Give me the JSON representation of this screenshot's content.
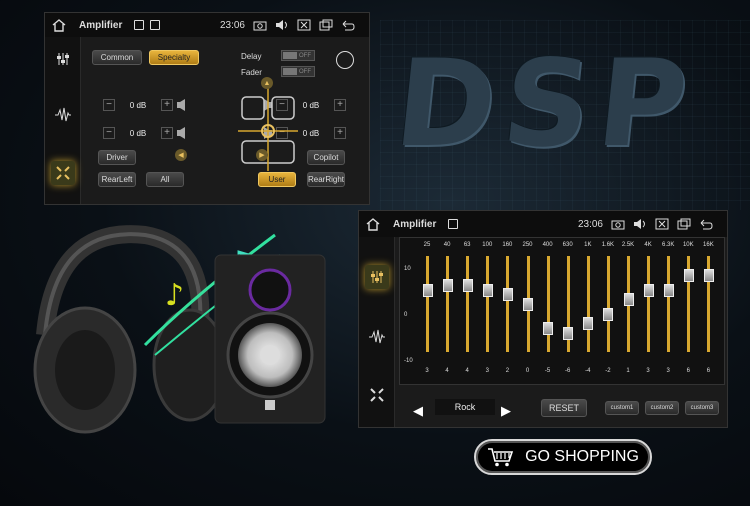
{
  "hero_text": "DSP",
  "amp_panel": {
    "title": "Amplifier",
    "time": "23:06",
    "tabs": [
      "Common",
      "Specialty"
    ],
    "delay_label": "Delay",
    "fader_label": "Fader",
    "toggle_off": "OFF",
    "db_values": [
      "0 dB",
      "0 dB",
      "0 dB",
      "0 dB"
    ],
    "buttons": {
      "driver": "Driver",
      "copilot": "Copilot",
      "rearleft": "RearLeft",
      "all": "All",
      "user": "User",
      "rearright": "RearRight"
    }
  },
  "eq_panel": {
    "title": "Amplifier",
    "time": "23:06",
    "axis": [
      "10",
      "0",
      "-10"
    ],
    "frequencies": [
      "25",
      "40",
      "63",
      "100",
      "160",
      "250",
      "400",
      "630",
      "1K",
      "1.6K",
      "2.5K",
      "4K",
      "6.3K",
      "10K",
      "16K"
    ],
    "levels": [
      3,
      4,
      4,
      3,
      2,
      0,
      -5,
      -6,
      -4,
      -2,
      1,
      3,
      3,
      6,
      6
    ],
    "preset": "Rock",
    "reset_label": "RESET",
    "custom": [
      "custom1",
      "custom2",
      "custom3"
    ]
  },
  "cta": {
    "label": "GO SHOPPING"
  },
  "colors": {
    "accent": "#d8a830",
    "background": "#0a1016"
  }
}
